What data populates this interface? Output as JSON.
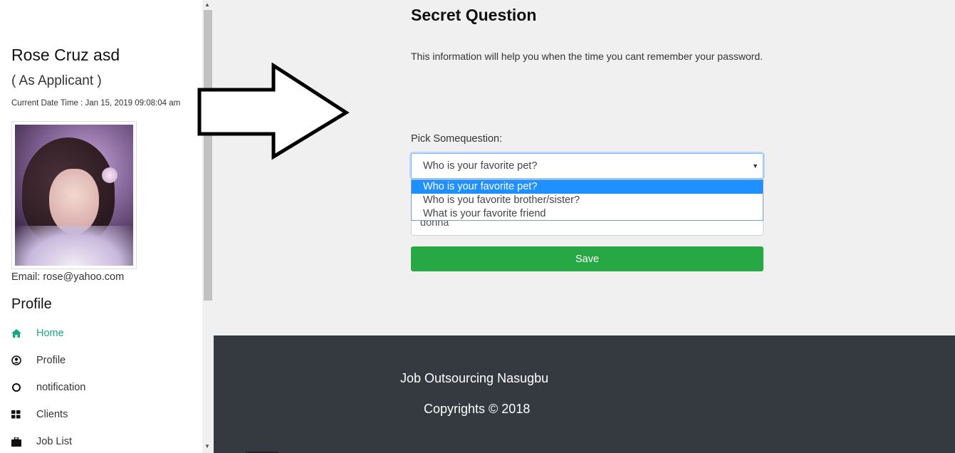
{
  "sidebar": {
    "user_name": "Rose Cruz asd",
    "role": "( As Applicant )",
    "datetime": "Current Date Time : Jan 15, 2019 09:08:04 am",
    "email": "Email: rose@yahoo.com",
    "section_title": "Profile",
    "nav": [
      {
        "label": "Home",
        "icon": "home-icon",
        "active": true
      },
      {
        "label": "Profile",
        "icon": "user-circle-icon",
        "active": false
      },
      {
        "label": "notification",
        "icon": "circle-icon",
        "active": false
      },
      {
        "label": "Clients",
        "icon": "grid-icon",
        "active": false
      },
      {
        "label": "Job List",
        "icon": "briefcase-icon",
        "active": false
      }
    ]
  },
  "main": {
    "title": "Secret Question",
    "description": "This information will help you when the time you cant remember your password.",
    "pick_label": "Pick Somequestion:",
    "select_value": "Who is your favorite pet?",
    "options": [
      "Who is your favorite pet?",
      "Who is you favorite brother/sister?",
      "What is your favorite friend"
    ],
    "selected_option_index": 0,
    "answer_value": "donna",
    "save_label": "Save"
  },
  "footer": {
    "company": "Job Outsourcing Nasugbu",
    "copyright": "Copyrights © 2018"
  },
  "colors": {
    "accent": "#17a589",
    "save": "#28a745",
    "footer_bg": "#343a40",
    "selected_option": "#1e90ff"
  }
}
